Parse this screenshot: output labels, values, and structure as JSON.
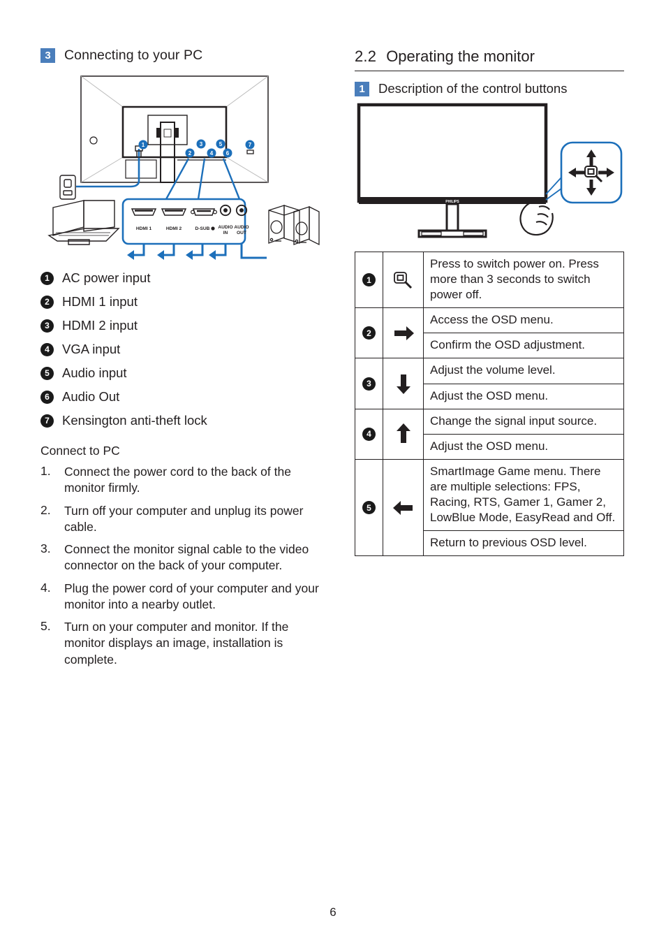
{
  "page_number": "6",
  "left": {
    "section_number": "3",
    "section_title": "Connecting to your PC",
    "diagram": {
      "port_captions": [
        "HDMI 1",
        "HDMI 2",
        "D-SUB",
        "AUDIO\nIN",
        "AUDIO\nOUT"
      ],
      "port_caption_hdmi1": "HDMI 1",
      "port_caption_hdmi2": "HDMI 2",
      "port_caption_dsub": "D-SUB",
      "port_caption_audio_in_1": "AUDIO",
      "port_caption_audio_in_2": "IN",
      "port_caption_audio_out_1": "AUDIO",
      "port_caption_audio_out_2": "OUT",
      "callouts": [
        "1",
        "2",
        "3",
        "4",
        "5",
        "6",
        "7"
      ]
    },
    "ports": [
      {
        "num": "1",
        "label": "AC power input"
      },
      {
        "num": "2",
        "label": "HDMI 1 input"
      },
      {
        "num": "3",
        "label": "HDMI 2 input"
      },
      {
        "num": "4",
        "label": "VGA input"
      },
      {
        "num": "5",
        "label": "Audio input"
      },
      {
        "num": "6",
        "label": "Audio Out"
      },
      {
        "num": "7",
        "label": "Kensington anti-theft lock"
      }
    ],
    "connect_heading": "Connect to PC",
    "steps": [
      {
        "num": "1.",
        "text": "Connect the power cord to the back of the monitor firmly."
      },
      {
        "num": "2.",
        "text": "Turn off your computer and unplug its power cable."
      },
      {
        "num": "3.",
        "text": "Connect the monitor signal cable to the video connector on the back of your computer."
      },
      {
        "num": "4.",
        "text": "Plug the power cord of your computer and your monitor into a nearby outlet."
      },
      {
        "num": "5.",
        "text": "Turn on your computer and monitor. If the monitor displays an image, installation is complete."
      }
    ]
  },
  "right": {
    "heading_number": "2.2",
    "heading_title": "Operating the monitor",
    "section_number": "1",
    "section_title": "Description of the control buttons",
    "monitor_brand": "PHILIPS",
    "control_table": [
      {
        "num": "1",
        "icon": "power-joystick-press-icon",
        "rows": [
          "Press to switch power on. Press more than 3 seconds to switch power off."
        ]
      },
      {
        "num": "2",
        "icon": "arrow-right-icon",
        "rows": [
          "Access the OSD menu.",
          "Confirm the OSD adjustment."
        ]
      },
      {
        "num": "3",
        "icon": "arrow-down-icon",
        "rows": [
          "Adjust the volume level.",
          "Adjust the OSD menu."
        ]
      },
      {
        "num": "4",
        "icon": "arrow-up-icon",
        "rows": [
          "Change the signal input source.",
          "Adjust the OSD menu."
        ]
      },
      {
        "num": "5",
        "icon": "arrow-left-icon",
        "rows": [
          "SmartImage Game menu. There are multiple selections: FPS, Racing, RTS, Gamer 1, Gamer 2, LowBlue Mode, EasyRead and Off.",
          "Return to previous OSD level."
        ]
      }
    ]
  },
  "colors": {
    "accent_blue": "#4a7ebb",
    "diagram_blue": "#1c6fba",
    "text": "#231f20"
  }
}
